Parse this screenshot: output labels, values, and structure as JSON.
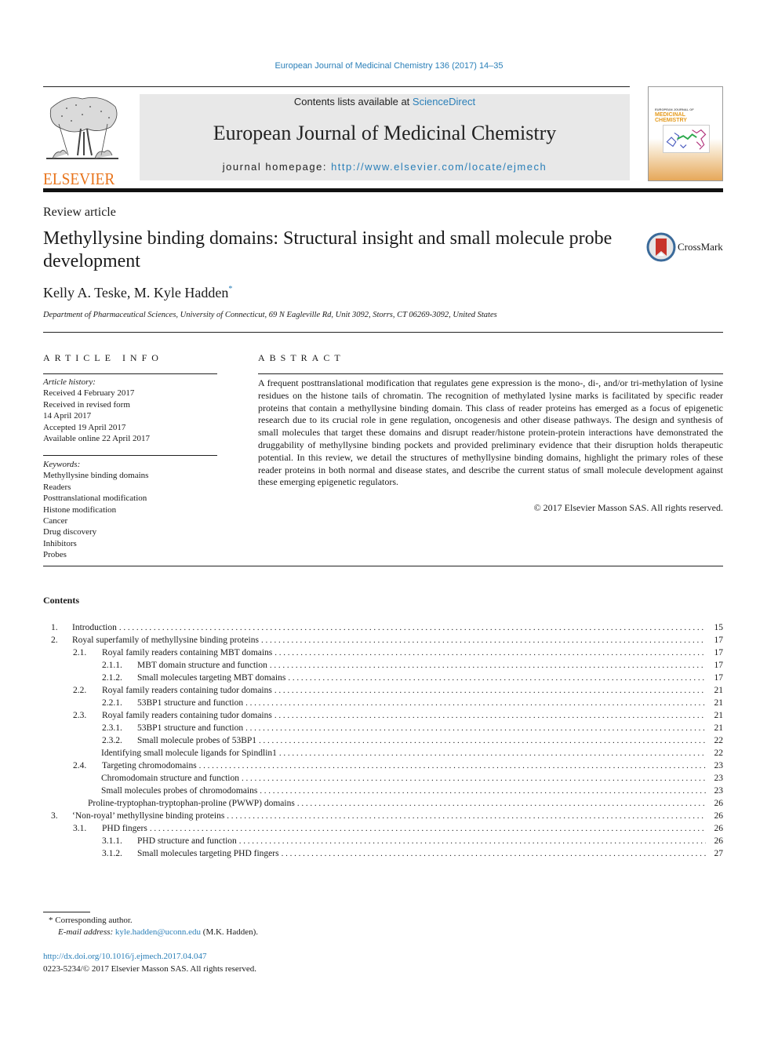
{
  "running_head": "European Journal of Medicinal Chemistry 136 (2017) 14–35",
  "publisher": {
    "logo_wordmark": "ELSEVIER",
    "logo_icon": "elsevier-tree-icon"
  },
  "masthead": {
    "contents_prefix": "Contents lists available at ",
    "contents_link": "ScienceDirect",
    "journal_name": "European Journal of Medicinal Chemistry",
    "homepage_prefix": "journal homepage: ",
    "homepage_url": "http://www.elsevier.com/locate/ejmech"
  },
  "cover": {
    "line1": "EUROPEAN JOURNAL OF",
    "line2": "MEDICINAL",
    "line3": "CHEMISTRY"
  },
  "article": {
    "type": "Review article",
    "title": "Methyllysine binding domains: Structural insight and small molecule probe development",
    "authors": "Kelly A. Teske, M. Kyle Hadden",
    "author_mark": "*",
    "affiliation": "Department of Pharmaceutical Sciences, University of Connecticut, 69 N Eagleville Rd, Unit 3092, Storrs, CT 06269-3092, United States"
  },
  "crossmark": {
    "label": "CrossMark",
    "icon": "crossmark-icon"
  },
  "article_info": {
    "heading": "ARTICLE INFO",
    "history_label": "Article history:",
    "history": [
      "Received 4 February 2017",
      "Received in revised form",
      "14 April 2017",
      "Accepted 19 April 2017",
      "Available online 22 April 2017"
    ],
    "keywords_label": "Keywords:",
    "keywords": [
      "Methyllysine binding domains",
      "Readers",
      "Posttranslational modification",
      "Histone modification",
      "Cancer",
      "Drug discovery",
      "Inhibitors",
      "Probes"
    ]
  },
  "abstract": {
    "heading": "ABSTRACT",
    "text": "A frequent posttranslational modification that regulates gene expression is the mono-, di-, and/or tri-methylation of lysine residues on the histone tails of chromatin. The recognition of methylated lysine marks is facilitated by specific reader proteins that contain a methyllysine binding domain. This class of reader proteins has emerged as a focus of epigenetic research due to its crucial role in gene regulation, oncogenesis and other disease pathways. The design and synthesis of small molecules that target these domains and disrupt reader/histone protein-protein interactions have demonstrated the druggability of methyllysine binding pockets and provided preliminary evidence that their disruption holds therapeutic potential. In this review, we detail the structures of methyllysine binding domains, highlight the primary roles of these reader proteins in both normal and disease states, and describe the current status of small molecule development against these emerging epigenetic regulators.",
    "copyright": "© 2017 Elsevier Masson SAS. All rights reserved."
  },
  "contents": {
    "heading": "Contents",
    "entries": [
      {
        "num": "1.",
        "label": "Introduction",
        "page": "15"
      },
      {
        "num": "2.",
        "label": "Royal superfamily of methyllysine binding proteins",
        "page": "17"
      },
      {
        "num": "2.1.",
        "label": "Royal family readers containing MBT domains",
        "page": "17"
      },
      {
        "num": "2.1.1.",
        "label": "MBT domain structure and function",
        "page": "17"
      },
      {
        "num": "2.1.2.",
        "label": "Small molecules targeting MBT domains",
        "page": "17"
      },
      {
        "num": "2.2.",
        "label": "Royal family readers containing tudor domains",
        "page": "21"
      },
      {
        "num": "2.2.1.",
        "label": "53BP1 structure and function",
        "page": "21"
      },
      {
        "num": "2.3.",
        "label": "Royal family readers containing tudor domains",
        "page": "21"
      },
      {
        "num": "2.3.1.",
        "label": "53BP1 structure and function",
        "page": "21"
      },
      {
        "num": "2.3.2.",
        "label": "Small molecule probes of 53BP1",
        "page": "22"
      },
      {
        "num": "",
        "label": "Identifying small molecule ligands for Spindlin1",
        "page": "22"
      },
      {
        "num": "2.4.",
        "label": "Targeting chromodomains",
        "page": "23"
      },
      {
        "num": "",
        "label": "Chromodomain structure and function",
        "page": "23"
      },
      {
        "num": "",
        "label": "Small molecules probes of chromodomains",
        "page": "23"
      },
      {
        "num": "",
        "label": "Proline-tryptophan-tryptophan-proline (PWWP) domains",
        "page": "26"
      },
      {
        "num": "3.",
        "label": "‘Non-royal’ methyllysine binding proteins",
        "page": "26"
      },
      {
        "num": "3.1.",
        "label": "PHD fingers",
        "page": "26"
      },
      {
        "num": "3.1.1.",
        "label": "PHD structure and function",
        "page": "26"
      },
      {
        "num": "3.1.2.",
        "label": "Small molecules targeting PHD fingers",
        "page": "27"
      }
    ]
  },
  "footnote": {
    "mark": "*",
    "corresponding": "Corresponding author.",
    "email_label": "E-mail address:",
    "email": "kyle.hadden@uconn.edu",
    "email_suffix": " (M.K. Hadden)."
  },
  "doi": {
    "url": "http://dx.doi.org/10.1016/j.ejmech.2017.04.047",
    "issn_line": "0223-5234/© 2017 Elsevier Masson SAS. All rights reserved."
  },
  "colors": {
    "link": "#2a7fb8",
    "elsevier_orange": "#e8731a",
    "masthead_gray": "#e8e8e8"
  }
}
